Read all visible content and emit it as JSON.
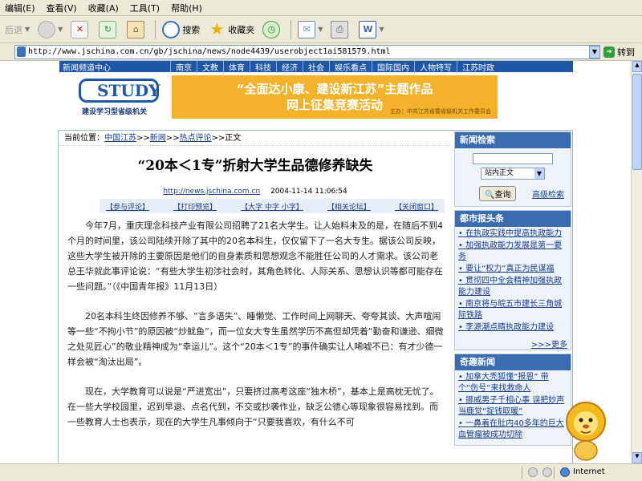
{
  "menu": [
    "编辑(E)",
    "查看(V)",
    "收藏(A)",
    "工具(T)",
    "帮助(H)"
  ],
  "toolbar": {
    "back": "后退",
    "search": "搜索",
    "favorites": "收藏夹"
  },
  "address": {
    "url": "http://www.jschina.com.cn/gb/jschina/news/node4439/userobject1ai581579.html",
    "go": "转到"
  },
  "site": {
    "home": "新闻频道中心",
    "nav": [
      "南京",
      "文教",
      "体育",
      "科技",
      "经济",
      "社会",
      "娱乐看点",
      "国际国内",
      "人物特写",
      "江苏时政"
    ],
    "logo_text": "STUDY",
    "logo_caption": "建设学习型省级机关",
    "banner_line1": "“全面达小康、建设新江苏”主题作品",
    "banner_line2": "网上征集竞赛活动",
    "banner_small": "主办：中共江苏省委省级机关工作委员会"
  },
  "breadcrumb": {
    "prefix": "当前位置：",
    "items": [
      "中国江苏",
      "新闻",
      "热点评论"
    ],
    "current": "正文"
  },
  "article": {
    "title": "“20本＜1专”折射大学生品德修养缺失",
    "source_link": "http://news.jschina.com.cn",
    "date": "2004-11-14 11:06:54",
    "tools": [
      "【参与评论】",
      "【打印预览】",
      "【大字 中字 小字】",
      "【相关论坛】",
      "【关闭窗口】"
    ],
    "paragraphs": [
      "今年7月，重庆理念科技产业有限公司招聘了21名大学生。让人始料未及的是，在随后不到4个月的时间里，该公司陆续开除了其中的20名本科生，仅仅留下了一名大专生。据该公司反映，这些大学生被开除的主要原因是他们的自身素质和思想观念不能胜任公司的人才需求。该公司老总王华就此事评论说：“有些大学生初涉社会时，其角色转化、人际关系、思想认识等都可能存在一些问题。”（《中国青年报》11月13日）",
      "20名本科生终因修养不够、“言多语失”、睡懒觉、工作时间上网聊天、夸夸其谈、大声喧闹等一些“不拘小节”的原因被“炒鱿鱼”，而一位女大专生虽然学历不高但却凭着“勤奋和谦逊、细微之处见匠心”的敬业精神成为“幸运儿”。这个“20本＜1专”的事件确实让人唏嘘不已：有才少德一样会被“淘汰出局”。",
      "现在，大学教育可以说是“严进宽出”，只要挤过高考这座“独木桥”，基本上是高枕无忧了。在一些大学校园里，迟到早退、点名代到，不交或抄袭作业，缺乏公德心等现象很容易找到。而一些教育人士也表示，现在的大学生凡事倾向于“只要我喜欢，有什么不可"
    ]
  },
  "sidebar": {
    "search_title": "新闻检索",
    "search_scope": "站内正文",
    "search_button": "查询",
    "advanced": "高级检索",
    "city_title": "都市报头条",
    "city_items": [
      "在执政实践中提高执政能力",
      "加强执政能力发展是第一要务",
      "要让“权力”真正为民谋福",
      "贯彻四中全会精神加强执政能力建设",
      "南京将与皖五市建长三角城际铁路",
      "李源潮点睛执政能力建设"
    ],
    "more": ">>>更多",
    "odd_title": "奇趣新闻",
    "odd_items": [
      "加拿大秃狐懂“报恩” 带个“伤号”来找救命人",
      "挪威男子千相心事 误把妙声当鹿觉“捉钱取暖”",
      "一鼻着在肚内40多年的巨大血管瘤被成功切除"
    ]
  },
  "status": {
    "zone": "Internet"
  }
}
